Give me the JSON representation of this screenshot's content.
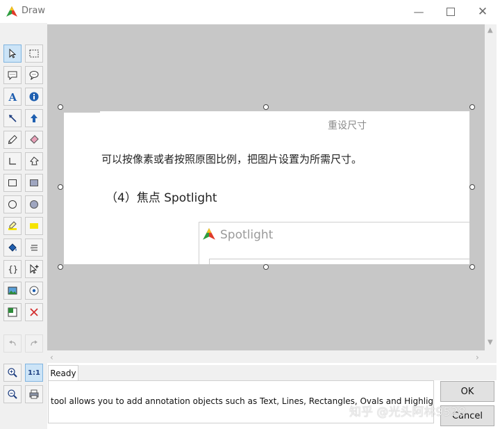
{
  "window": {
    "title": "Draw"
  },
  "toolbox": {
    "tools": [
      {
        "id": "select",
        "icon": "pointer-arrow-icon",
        "selected": true
      },
      {
        "id": "marquee",
        "icon": "marquee-rect-icon"
      },
      {
        "id": "callout-rect",
        "icon": "callout-rect-icon"
      },
      {
        "id": "callout-oval",
        "icon": "callout-oval-icon"
      },
      {
        "id": "text",
        "icon": "text-a-icon"
      },
      {
        "id": "info",
        "icon": "info-circle-icon"
      },
      {
        "id": "arrow-line",
        "icon": "arrow-diagonal-icon"
      },
      {
        "id": "arrow-up",
        "icon": "arrow-up-icon"
      },
      {
        "id": "pen",
        "icon": "pen-icon"
      },
      {
        "id": "eraser",
        "icon": "eraser-icon"
      },
      {
        "id": "polyline",
        "icon": "polyline-icon"
      },
      {
        "id": "polygon",
        "icon": "polygon-icon"
      },
      {
        "id": "rect",
        "icon": "rectangle-outline-icon"
      },
      {
        "id": "rect-filled",
        "icon": "rectangle-filled-icon"
      },
      {
        "id": "oval",
        "icon": "oval-outline-icon"
      },
      {
        "id": "oval-filled",
        "icon": "oval-filled-icon"
      },
      {
        "id": "highlighter",
        "icon": "highlighter-icon"
      },
      {
        "id": "highlight-rect",
        "icon": "highlight-rect-icon"
      },
      {
        "id": "fill",
        "icon": "paint-bucket-icon"
      },
      {
        "id": "lines-style",
        "icon": "line-style-icon"
      },
      {
        "id": "braces",
        "icon": "braces-icon"
      },
      {
        "id": "pointer-add",
        "icon": "pointer-plus-icon"
      },
      {
        "id": "image",
        "icon": "image-icon"
      },
      {
        "id": "spotlight",
        "icon": "spotlight-icon"
      },
      {
        "id": "crop",
        "icon": "crop-icon"
      },
      {
        "id": "delete",
        "icon": "delete-x-icon"
      },
      {
        "id": "undo",
        "icon": "undo-icon",
        "disabled": true
      },
      {
        "id": "redo",
        "icon": "redo-icon",
        "disabled": true
      },
      {
        "id": "zoom-in",
        "icon": "zoom-in-icon"
      },
      {
        "id": "actual-size",
        "icon": "actual-size-icon",
        "label": "1:1",
        "selected": true
      },
      {
        "id": "zoom-out",
        "icon": "zoom-out-icon"
      },
      {
        "id": "print",
        "icon": "print-icon"
      }
    ]
  },
  "canvas": {
    "heading": "重设尺寸",
    "line1": "可以按像素或者按照原图比例，把图片设置为所需尺寸。",
    "line2": "（4）焦点 Spotlight",
    "window_title": "Spotlight"
  },
  "status": {
    "tab_label": "Ready",
    "text": "tool allows you to add annotation objects such as Text, Lines, Rectangles, Ovals and Highlights to the im"
  },
  "buttons": {
    "ok": "OK",
    "cancel": "Cancel"
  },
  "watermark": "知乎 @光头阿林9528",
  "colors": {
    "selection": "#cce4f7",
    "canvas_bg": "#c7c7c7",
    "delete_red": "#d32f2f",
    "icon_blue": "#1f5fb0"
  }
}
